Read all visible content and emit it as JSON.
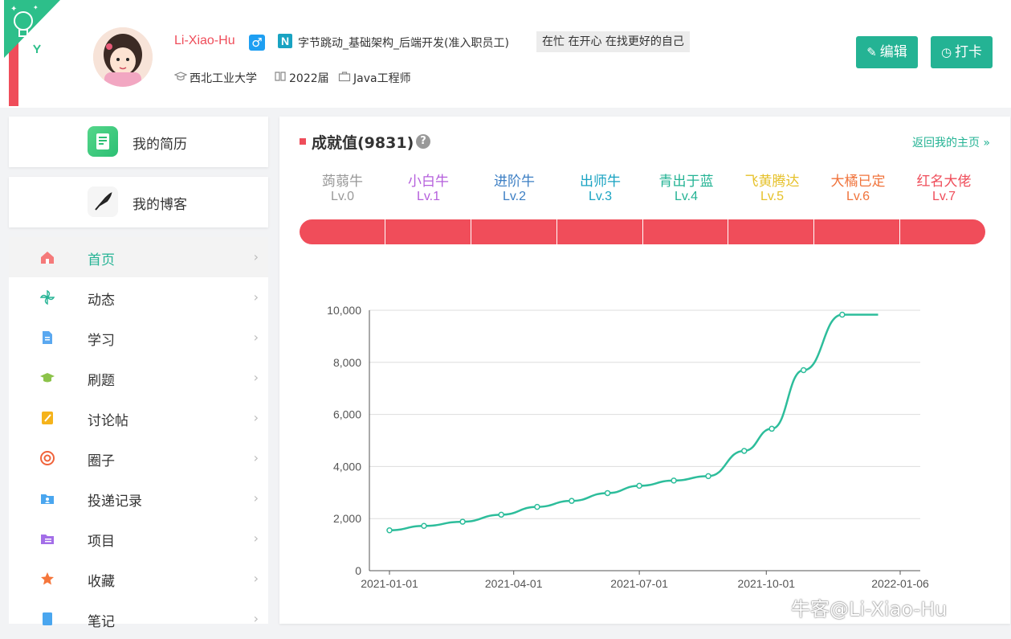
{
  "header": {
    "username": "Li-Xiao-Hu",
    "gender_symbol": "♂",
    "company_badge": "N",
    "company": "字节跳动_基础架构_后端开发(准入职员工)",
    "status": "在忙 在开心 在找更好的自己",
    "school": "西北工业大学",
    "grad_year": "2022届",
    "job": "Java工程师",
    "edit_label": "编辑",
    "checkin_label": "打卡"
  },
  "sidebar": {
    "resume_label": "我的简历",
    "blog_label": "我的博客",
    "items": [
      {
        "label": "首页",
        "icon": "home-icon",
        "color": "#f57a7a"
      },
      {
        "label": "动态",
        "icon": "pinwheel-icon",
        "color": "#24b394"
      },
      {
        "label": "学习",
        "icon": "document-icon",
        "color": "#5aa8f0"
      },
      {
        "label": "刷题",
        "icon": "graduation-cap-icon",
        "color": "#8cc34a"
      },
      {
        "label": "讨论帖",
        "icon": "note-pencil-icon",
        "color": "#f5b31b"
      },
      {
        "label": "圈子",
        "icon": "target-circle-icon",
        "color": "#f0633b"
      },
      {
        "label": "投递记录",
        "icon": "folder-person-icon",
        "color": "#4aa6ef"
      },
      {
        "label": "项目",
        "icon": "folder-list-icon",
        "color": "#a36ee8"
      },
      {
        "label": "收藏",
        "icon": "star-icon",
        "color": "#f5763b"
      },
      {
        "label": "笔记",
        "icon": "notebook-icon",
        "color": "#4aa6ef"
      }
    ]
  },
  "main": {
    "title": "成就值(9831)",
    "help": "?",
    "back_link": "返回我的主页 »",
    "levels": [
      {
        "name": "蒟蒻牛",
        "lv": "Lv.0",
        "color": "#999999"
      },
      {
        "name": "小白牛",
        "lv": "Lv.1",
        "color": "#b55fdc"
      },
      {
        "name": "进阶牛",
        "lv": "Lv.2",
        "color": "#3d7fc4"
      },
      {
        "name": "出师牛",
        "lv": "Lv.3",
        "color": "#19a3c2"
      },
      {
        "name": "青出于蓝",
        "lv": "Lv.4",
        "color": "#24b394"
      },
      {
        "name": "飞黄腾达",
        "lv": "Lv.5",
        "color": "#e6c12a"
      },
      {
        "name": "大橘已定",
        "lv": "Lv.6",
        "color": "#f0733b"
      },
      {
        "name": "红名大佬",
        "lv": "Lv.7",
        "color": "#ef4d5a"
      }
    ],
    "progress": 1.0
  },
  "chart_data": {
    "type": "line",
    "x": [
      "2021-01-01",
      "2021-01-26",
      "2021-02-23",
      "2021-03-23",
      "2021-04-18",
      "2021-05-13",
      "2021-06-08",
      "2021-07-01",
      "2021-07-26",
      "2021-08-20",
      "2021-09-15",
      "2021-10-05",
      "2021-10-28",
      "2021-11-25",
      "2021-12-21"
    ],
    "values": [
      1550,
      1720,
      1880,
      2150,
      2450,
      2680,
      2980,
      3260,
      3460,
      3630,
      4600,
      5450,
      7700,
      9831,
      9831
    ],
    "xticks": [
      "2021-01-01",
      "2021-04-01",
      "2021-07-01",
      "2021-10-01",
      "2022-01-06"
    ],
    "yticks": [
      "0",
      "2,000",
      "4,000",
      "6,000",
      "8,000",
      "10,000"
    ],
    "ylim": [
      0,
      10000
    ],
    "grid": true,
    "color": "#2dbd9b"
  },
  "watermark": "牛客@Li-Xiao-Hu"
}
